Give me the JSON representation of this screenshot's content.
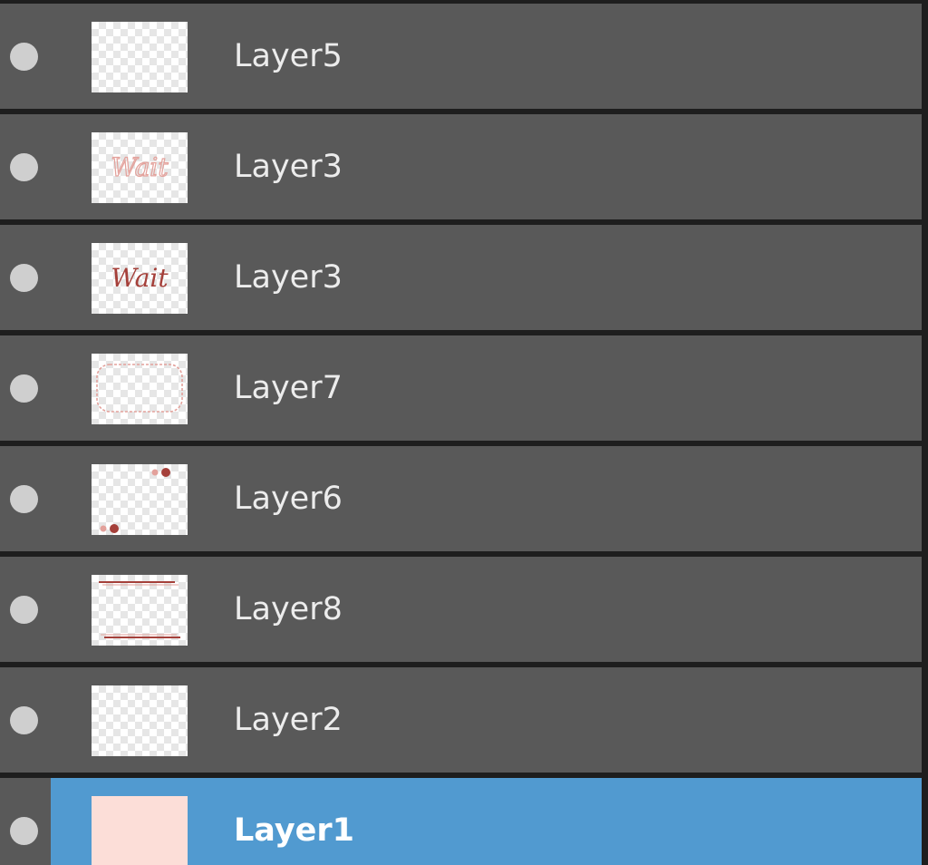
{
  "layers": [
    {
      "name": "Layer5",
      "thumb": "empty",
      "visible": true,
      "selected": false
    },
    {
      "name": "Layer3",
      "thumb": "wait-outline",
      "visible": true,
      "selected": false
    },
    {
      "name": "Layer3",
      "thumb": "wait-solid",
      "visible": true,
      "selected": false
    },
    {
      "name": "Layer7",
      "thumb": "frame-border",
      "visible": true,
      "selected": false
    },
    {
      "name": "Layer6",
      "thumb": "corner-dots",
      "visible": true,
      "selected": false
    },
    {
      "name": "Layer8",
      "thumb": "top-bottom-lines",
      "visible": true,
      "selected": false
    },
    {
      "name": "Layer2",
      "thumb": "empty",
      "visible": true,
      "selected": false
    },
    {
      "name": "Layer1",
      "thumb": "solid-fill",
      "visible": true,
      "selected": true
    }
  ],
  "thumb_text": "Wait",
  "colors": {
    "row_bg": "#595959",
    "selected_bg": "#519ad0",
    "panel_bg": "#1e1e1e",
    "ink": "#a5403a",
    "ink_light": "#e3a19b",
    "fill": "#fcded8"
  }
}
